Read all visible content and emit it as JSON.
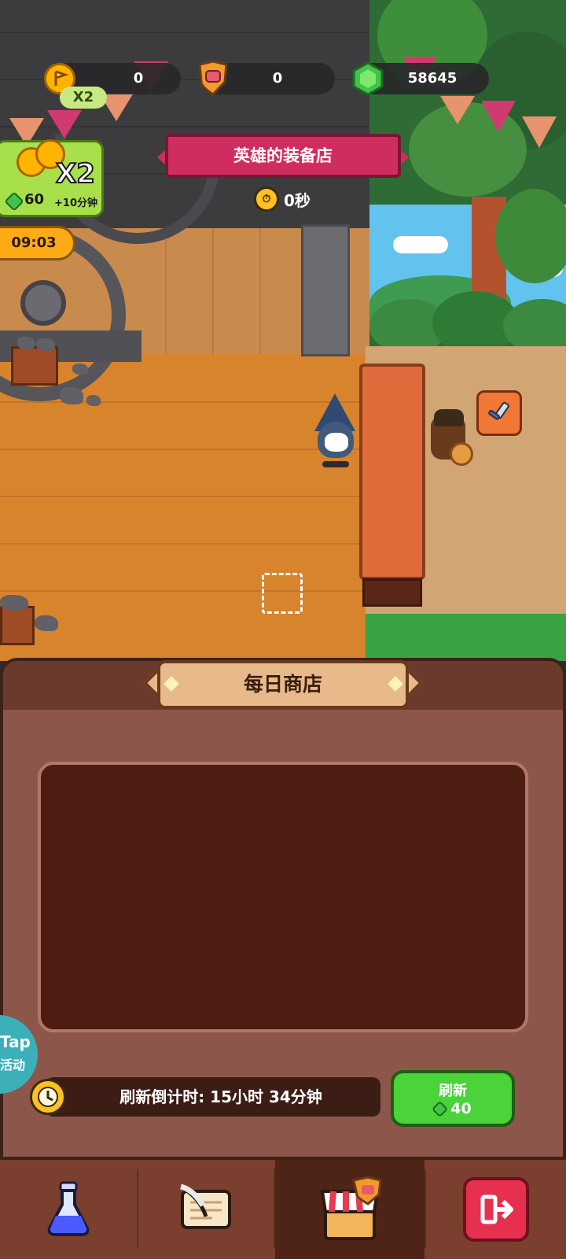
{
  "hud": {
    "coins": "0",
    "coin_multiplier": "X2",
    "trophies": "0",
    "gems": "58645"
  },
  "shop_title": "英雄的装备店",
  "timer": "0秒",
  "boost": {
    "multiplier": "X2",
    "cost": "60",
    "bonus": "+10分钟",
    "time_left": "09:03"
  },
  "daily_shop": {
    "title": "每日商店",
    "refresh_countdown": "刷新倒计时: 15小时 34分钟",
    "refresh_label": "刷新",
    "refresh_cost": "40"
  },
  "tap_badge": {
    "line1": "Tap",
    "line2": "活动"
  },
  "nav": {
    "tabs": [
      "potion-icon",
      "scroll-quill-icon",
      "shop-stall-icon",
      "exit-icon"
    ]
  },
  "colors": {
    "gem_green": "#42c34a",
    "coin_gold": "#ffb400",
    "banner_red": "#cf2d5f",
    "button_green": "#4bd33a",
    "exit_red": "#e7304f"
  }
}
